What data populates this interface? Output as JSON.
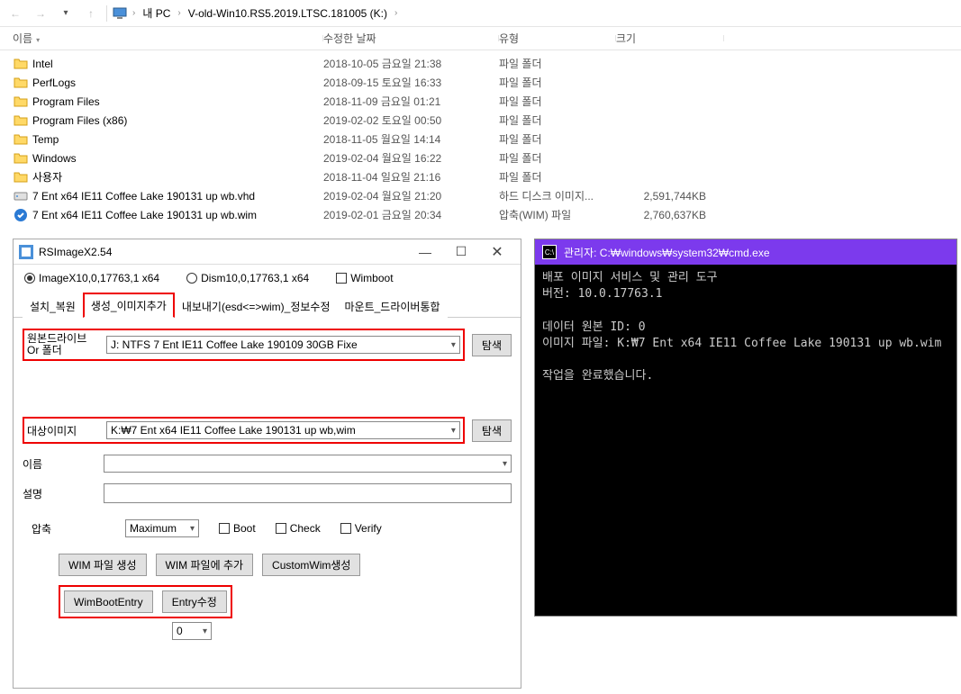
{
  "nav": {
    "crumb1": "내 PC",
    "crumb2": "V-old-Win10.RS5.2019.LTSC.181005 (K:)"
  },
  "columns": {
    "name": "이름",
    "date": "수정한 날짜",
    "type": "유형",
    "size": "크기"
  },
  "files": [
    {
      "name": "Intel",
      "date": "2018-10-05 금요일 21:38",
      "type": "파일 폴더",
      "size": "",
      "icon": "folder"
    },
    {
      "name": "PerfLogs",
      "date": "2018-09-15 토요일 16:33",
      "type": "파일 폴더",
      "size": "",
      "icon": "folder"
    },
    {
      "name": "Program Files",
      "date": "2018-11-09 금요일 01:21",
      "type": "파일 폴더",
      "size": "",
      "icon": "folder"
    },
    {
      "name": "Program Files (x86)",
      "date": "2019-02-02 토요일 00:50",
      "type": "파일 폴더",
      "size": "",
      "icon": "folder"
    },
    {
      "name": "Temp",
      "date": "2018-11-05 월요일 14:14",
      "type": "파일 폴더",
      "size": "",
      "icon": "folder"
    },
    {
      "name": "Windows",
      "date": "2019-02-04 월요일 16:22",
      "type": "파일 폴더",
      "size": "",
      "icon": "folder"
    },
    {
      "name": "사용자",
      "date": "2018-11-04 일요일 21:16",
      "type": "파일 폴더",
      "size": "",
      "icon": "folder"
    },
    {
      "name": "7 Ent x64 IE11 Coffee Lake 190131 up wb.vhd",
      "date": "2019-02-04 월요일 21:20",
      "type": "하드 디스크 이미지...",
      "size": "2,591,744KB",
      "icon": "disk"
    },
    {
      "name": "7 Ent x64 IE11 Coffee Lake 190131 up wb.wim",
      "date": "2019-02-01 금요일 20:34",
      "type": "압축(WIM) 파일",
      "size": "2,760,637KB",
      "icon": "wim"
    }
  ],
  "rsimage": {
    "title": "RSImageX2.54",
    "radio1": "ImageX10,0,17763,1 x64",
    "radio2": "Dism10,0,17763,1 x64",
    "wimboot": "Wimboot",
    "tabs": {
      "t1": "설치_복원",
      "t2": "생성_이미지추가",
      "t3": "내보내기(esd<=>wim)_정보수정",
      "t4": "마운트_드라이버통합"
    },
    "labels": {
      "source": "원본드라이브\nOr 폴더",
      "target": "대상이미지",
      "name": "이름",
      "desc": "설명",
      "compress": "압축",
      "browse": "탐색"
    },
    "values": {
      "source": "J: NTFS  7 Ent IE11 Coffee Lake 190109    30GB  Fixe",
      "target": "K:₩7 Ent x64 IE11 Coffee Lake 190131 up wb,wim",
      "compress": "Maximum",
      "zero": "0"
    },
    "checks": {
      "boot": "Boot",
      "check": "Check",
      "verify": "Verify"
    },
    "buttons": {
      "b1": "WIM 파일 생성",
      "b2": "WIM 파일에 추가",
      "b3": "CustomWim생성",
      "b4": "WimBootEntry",
      "b5": "Entry수정"
    }
  },
  "cmd": {
    "title": "관리자: C:₩windows₩system32₩cmd.exe",
    "body": "배포 이미지 서비스 및 관리 도구\n버전: 10.0.17763.1\n\n데이터 원본 ID: 0\n이미지 파일: K:₩7 Ent x64 IE11 Coffee Lake 190131 up wb.wim\n\n작업을 완료했습니다."
  }
}
